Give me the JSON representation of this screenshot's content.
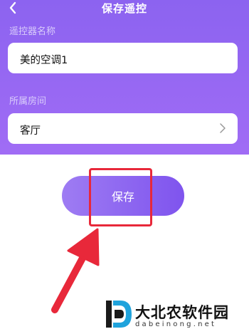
{
  "header": {
    "title": "保存遥控",
    "back_icon": "chevron-left-icon"
  },
  "form": {
    "remote_name_label": "遥控器名称",
    "remote_name_value": "美的空调1",
    "room_label": "所属房间",
    "room_value": "客厅",
    "room_chevron_icon": "chevron-right-icon"
  },
  "actions": {
    "save_label": "保存"
  },
  "annotation": {
    "highlight_color": "#e8283a",
    "arrow_color": "#e8283a"
  },
  "watermark": {
    "name": "大北农软件园",
    "url": "dabeinong.net"
  },
  "colors": {
    "header_bg": "#8c63f0",
    "button_gradient_start": "#9e7cf3",
    "button_gradient_end": "#7f54ee"
  }
}
